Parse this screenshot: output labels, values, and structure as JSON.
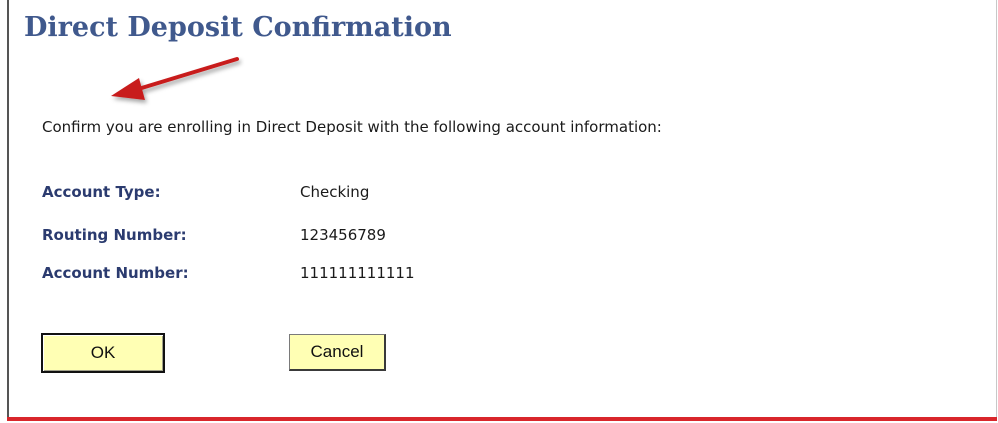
{
  "page": {
    "title": "Direct Deposit Confirmation",
    "instruction": "Confirm you are enrolling in Direct Deposit with the following account information:"
  },
  "fields": {
    "account_type": {
      "label": "Account Type:",
      "value": "Checking"
    },
    "routing_number": {
      "label": "Routing Number:",
      "value": "123456789"
    },
    "account_number": {
      "label": "Account Number:",
      "value": "111111111111"
    }
  },
  "buttons": {
    "ok_label": "OK",
    "cancel_label": "Cancel"
  },
  "annotation": {
    "icon": "red-arrow-icon",
    "color": "#c81e1e"
  },
  "colors": {
    "title": "#40598d",
    "label": "#2b3b6f",
    "button_fill": "#ffffb4",
    "bottom_rule": "#d9262b"
  }
}
